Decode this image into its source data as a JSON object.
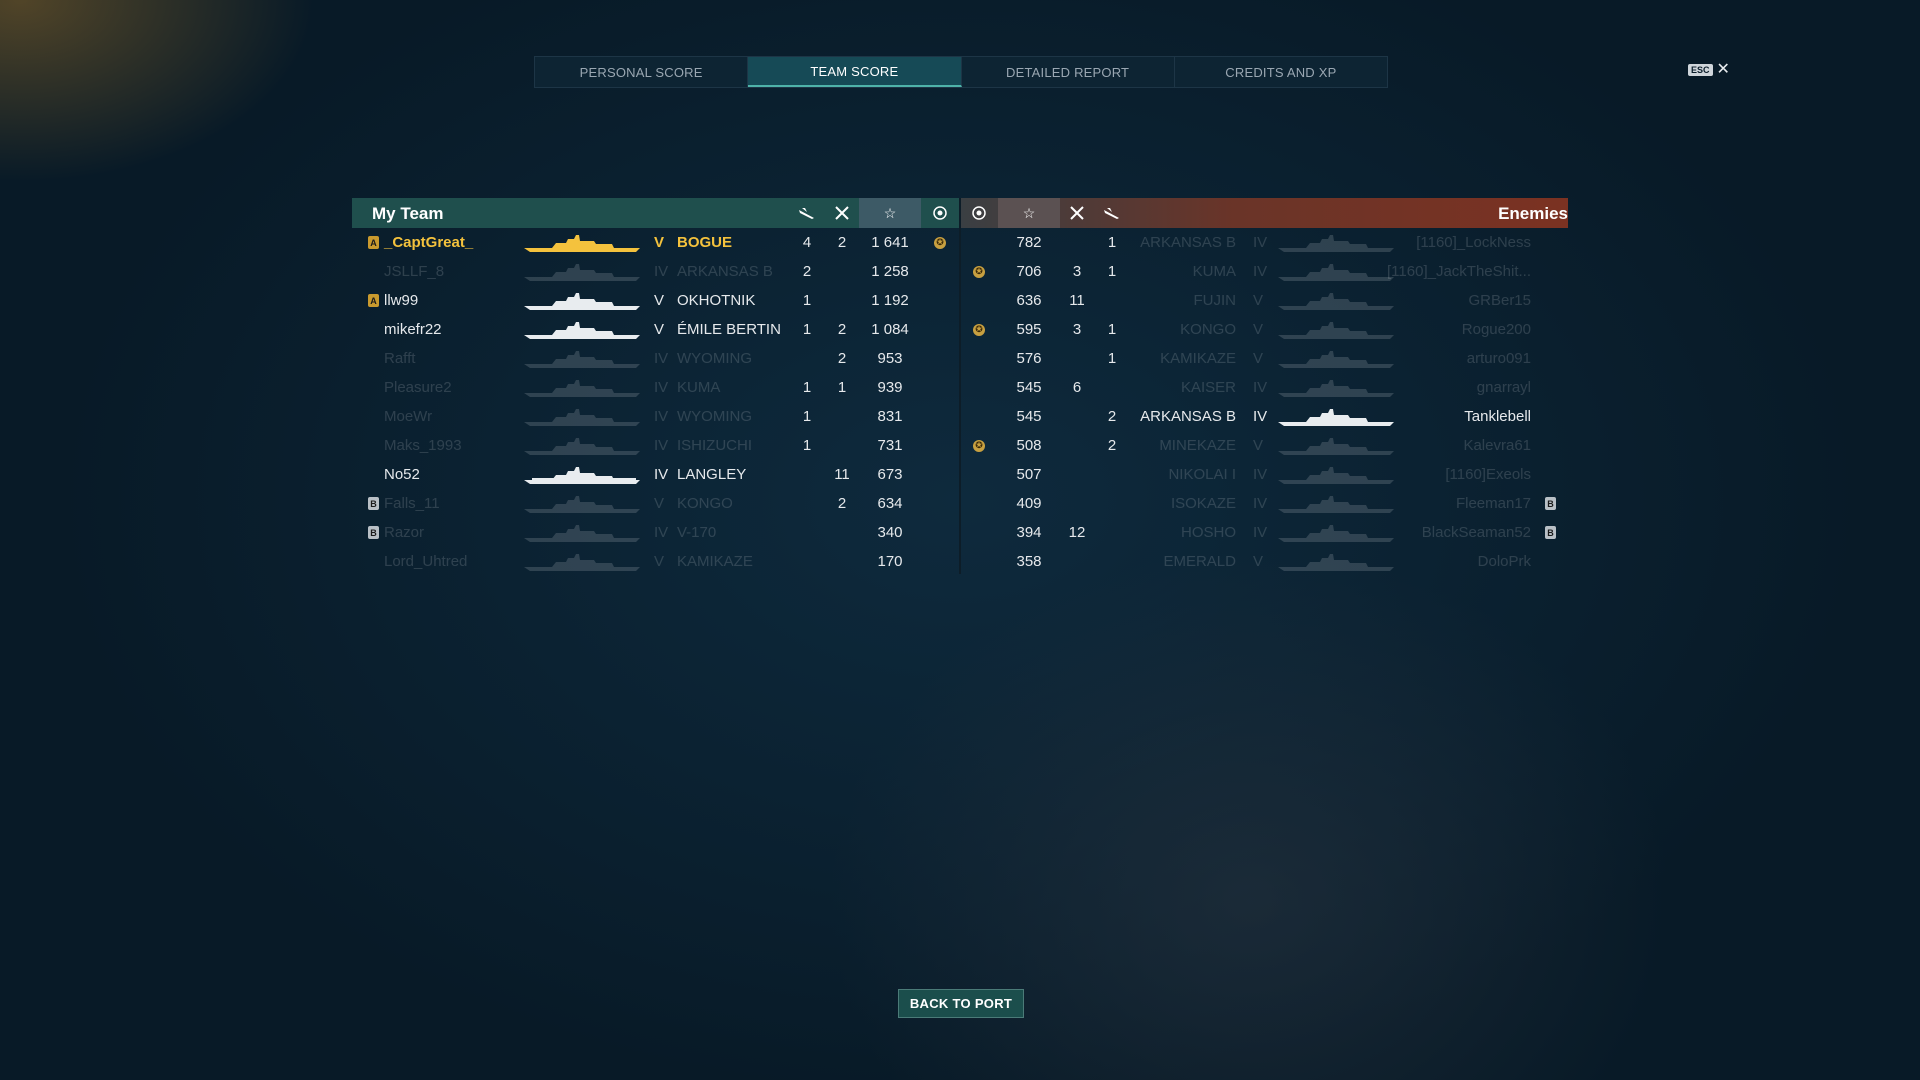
{
  "tabs": [
    {
      "label": "PERSONAL SCORE"
    },
    {
      "label": "TEAM SCORE"
    },
    {
      "label": "DETAILED REPORT"
    },
    {
      "label": "CREDITS AND XP"
    }
  ],
  "active_tab": "TEAM SCORE",
  "esc_label": "ESC",
  "my_team": {
    "title": "My Team",
    "columns_icons": [
      "plane-icon",
      "crossed-guns-icon",
      "star-icon",
      "medal-icon"
    ],
    "rows": [
      {
        "player": "_CaptGreat_",
        "badge": "A",
        "tier": "V",
        "ship": "BOGUE",
        "c1": "4",
        "c2": "2",
        "score": "1 641",
        "medal": true,
        "highlight": true,
        "dim": false
      },
      {
        "player": "JSLLF_8",
        "badge": "",
        "tier": "IV",
        "ship": "ARKANSAS B",
        "c1": "2",
        "c2": "",
        "score": "1 258",
        "medal": false,
        "highlight": false,
        "dim": true
      },
      {
        "player": "llw99",
        "badge": "A",
        "tier": "V",
        "ship": "OKHOTNIK",
        "c1": "1",
        "c2": "",
        "score": "1 192",
        "medal": false,
        "highlight": false,
        "dim": false
      },
      {
        "player": "mikefr22",
        "badge": "",
        "tier": "V",
        "ship": "ÉMILE BERTIN",
        "c1": "1",
        "c2": "2",
        "score": "1 084",
        "medal": false,
        "highlight": false,
        "dim": false
      },
      {
        "player": "Rafft",
        "badge": "",
        "tier": "IV",
        "ship": "WYOMING",
        "c1": "",
        "c2": "2",
        "score": "953",
        "medal": false,
        "highlight": false,
        "dim": true
      },
      {
        "player": "Pleasure2",
        "badge": "",
        "tier": "IV",
        "ship": "KUMA",
        "c1": "1",
        "c2": "1",
        "score": "939",
        "medal": false,
        "highlight": false,
        "dim": true
      },
      {
        "player": "MoeWr",
        "badge": "",
        "tier": "IV",
        "ship": "WYOMING",
        "c1": "1",
        "c2": "",
        "score": "831",
        "medal": false,
        "highlight": false,
        "dim": true
      },
      {
        "player": "Maks_1993",
        "badge": "",
        "tier": "IV",
        "ship": "ISHIZUCHI",
        "c1": "1",
        "c2": "",
        "score": "731",
        "medal": false,
        "highlight": false,
        "dim": true
      },
      {
        "player": "No52",
        "badge": "",
        "tier": "IV",
        "ship": "LANGLEY",
        "c1": "",
        "c2": "11",
        "score": "673",
        "medal": false,
        "highlight": false,
        "dim": false
      },
      {
        "player": "Falls_11",
        "badge": "B",
        "tier": "V",
        "ship": "KONGO",
        "c1": "",
        "c2": "2",
        "score": "634",
        "medal": false,
        "highlight": false,
        "dim": true
      },
      {
        "player": "Razor",
        "badge": "B",
        "tier": "IV",
        "ship": "V-170",
        "c1": "",
        "c2": "",
        "score": "340",
        "medal": false,
        "highlight": false,
        "dim": true
      },
      {
        "player": "Lord_Uhtred",
        "badge": "",
        "tier": "V",
        "ship": "KAMIKAZE",
        "c1": "",
        "c2": "",
        "score": "170",
        "medal": false,
        "highlight": false,
        "dim": true
      }
    ]
  },
  "enemies": {
    "title": "Enemies",
    "columns_icons": [
      "medal-icon",
      "star-icon",
      "crossed-guns-icon",
      "plane-icon"
    ],
    "rows": [
      {
        "player": "[1160]_LockNess",
        "badge": "",
        "tier": "IV",
        "ship": "ARKANSAS B",
        "score": "782",
        "c2": "",
        "c1": "1",
        "medal": false,
        "dim": true
      },
      {
        "player": "[1160]_JackTheShit...",
        "badge": "",
        "tier": "IV",
        "ship": "KUMA",
        "score": "706",
        "c2": "3",
        "c1": "1",
        "medal": true,
        "dim": true
      },
      {
        "player": "GRBer15",
        "badge": "",
        "tier": "V",
        "ship": "FUJIN",
        "score": "636",
        "c2": "11",
        "c1": "",
        "medal": false,
        "dim": true
      },
      {
        "player": "Rogue200",
        "badge": "",
        "tier": "V",
        "ship": "KONGO",
        "score": "595",
        "c2": "3",
        "c1": "1",
        "medal": true,
        "dim": true
      },
      {
        "player": "arturo091",
        "badge": "",
        "tier": "V",
        "ship": "KAMIKAZE",
        "score": "576",
        "c2": "",
        "c1": "1",
        "medal": false,
        "dim": true
      },
      {
        "player": "gnarrayl",
        "badge": "",
        "tier": "IV",
        "ship": "KAISER",
        "score": "545",
        "c2": "6",
        "c1": "",
        "medal": false,
        "dim": true
      },
      {
        "player": "Tanklebell",
        "badge": "",
        "tier": "IV",
        "ship": "ARKANSAS B",
        "score": "545",
        "c2": "",
        "c1": "2",
        "medal": false,
        "dim": false
      },
      {
        "player": "Kalevra61",
        "badge": "",
        "tier": "V",
        "ship": "MINEKAZE",
        "score": "508",
        "c2": "",
        "c1": "2",
        "medal": true,
        "dim": true
      },
      {
        "player": "[1160]Exeols",
        "badge": "",
        "tier": "IV",
        "ship": "NIKOLAI I",
        "score": "507",
        "c2": "",
        "c1": "",
        "medal": false,
        "dim": true
      },
      {
        "player": "Fleeman17",
        "badge": "B",
        "tier": "IV",
        "ship": "ISOKAZE",
        "score": "409",
        "c2": "",
        "c1": "",
        "medal": false,
        "dim": true
      },
      {
        "player": "BlackSeaman52",
        "badge": "B",
        "tier": "IV",
        "ship": "HOSHO",
        "score": "394",
        "c2": "12",
        "c1": "",
        "medal": false,
        "dim": true
      },
      {
        "player": "DoloPrk",
        "badge": "",
        "tier": "V",
        "ship": "EMERALD",
        "score": "358",
        "c2": "",
        "c1": "",
        "medal": false,
        "dim": true
      }
    ]
  },
  "back_button": "BACK TO PORT",
  "colors": {
    "highlight": "#f4c23d",
    "my_team_header": "#1f4f4d",
    "enemy_header": "#7b3222"
  }
}
